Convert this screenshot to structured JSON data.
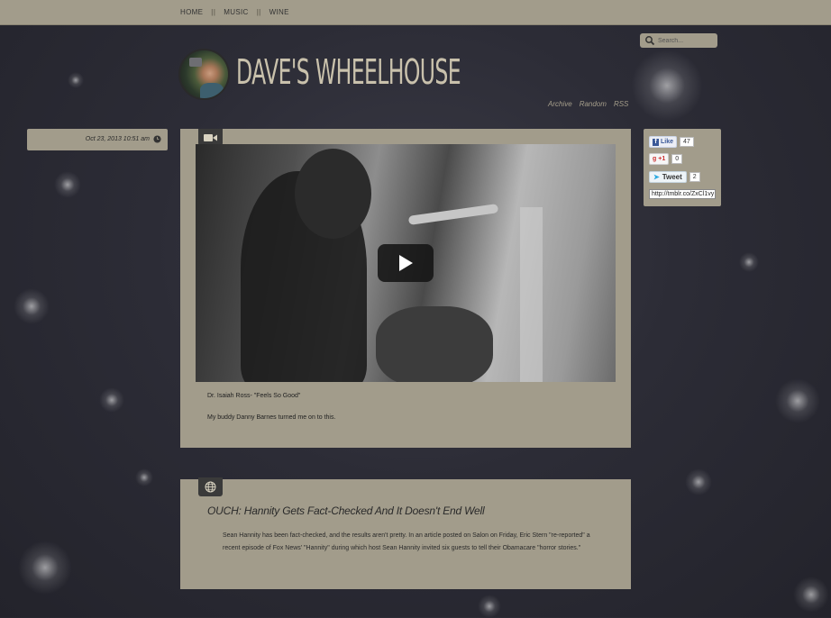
{
  "nav": {
    "items": [
      "HOME",
      "MUSIC",
      "WINE"
    ],
    "separator": "||"
  },
  "search": {
    "placeholder": "Search..."
  },
  "blog": {
    "title": "Dave's Wheelhouse"
  },
  "sublinks": [
    "Archive",
    "Random",
    "RSS"
  ],
  "post_meta": {
    "date": "Oct 23, 2013 10:51 am"
  },
  "post1": {
    "type_icon": "video-camera-icon",
    "caption": "Dr. Isaiah Ross- \"Feels So Good\"",
    "text": "My buddy Danny Barnes turned me on to this."
  },
  "post2": {
    "type_icon": "globe-icon",
    "title": "OUCH: Hannity Gets Fact-Checked And It Doesn't End Well",
    "body": "Sean Hannity has been fact-checked, and the results aren't pretty. In an article posted on Salon on Friday, Eric Stern \"re-reported\" a recent episode of Fox News' \"Hannity\" during which host Sean Hannity invited six guests to tell their Obamacare \"horror stories.\""
  },
  "share": {
    "like_label": "Like",
    "like_count": "47",
    "gplus_label": "+1",
    "gplus_count": "0",
    "tweet_label": "Tweet",
    "tweet_count": "2",
    "short_url": "http://tmblr.co/ZxCl1vy"
  }
}
